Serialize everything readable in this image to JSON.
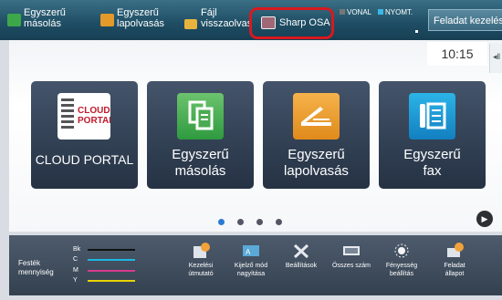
{
  "topbar": {
    "items": [
      {
        "label": "Egyszerű\nmásolás",
        "icon": "simple-copy-icon"
      },
      {
        "label": "Egyszerű\nlapolvasás",
        "icon": "simple-scan-icon"
      },
      {
        "label": "Fájl\nvisszaolvas",
        "icon": "file-retrieve-icon"
      },
      {
        "label": "Sharp OSA",
        "icon": "sharp-osa-icon"
      }
    ],
    "status_line": "VONAL",
    "status_print": "NYOMT.",
    "job_button": "Feladat kezelés",
    "highlight_color": "#d71920"
  },
  "clock": "10:15",
  "tiles": [
    {
      "label": "CLOUD PORTAL",
      "logo_text": "CLOUD\nPORTAL"
    },
    {
      "label": "Egyszerű\nmásolás"
    },
    {
      "label": "Egyszerű\nlapolvasás"
    },
    {
      "label": "Egyszerű\nfax"
    }
  ],
  "pagination": {
    "pages": 4,
    "current": 1
  },
  "toner": {
    "label": "Festék\nmennyiség",
    "rows": [
      {
        "name": "Bk",
        "color": "#111111"
      },
      {
        "name": "C",
        "color": "#1eb6e0"
      },
      {
        "name": "M",
        "color": "#d63b8e"
      },
      {
        "name": "Y",
        "color": "#e8d400"
      }
    ]
  },
  "bottombar": {
    "items": [
      {
        "label": "Kezelési\nútmutató"
      },
      {
        "label": "Kijelző mód\nnagyítása"
      },
      {
        "label": "Beállítások"
      },
      {
        "label": "Összes szám"
      },
      {
        "label": "Fényesség\nbeállítás"
      },
      {
        "label": "Feladat\nállapot"
      }
    ]
  }
}
